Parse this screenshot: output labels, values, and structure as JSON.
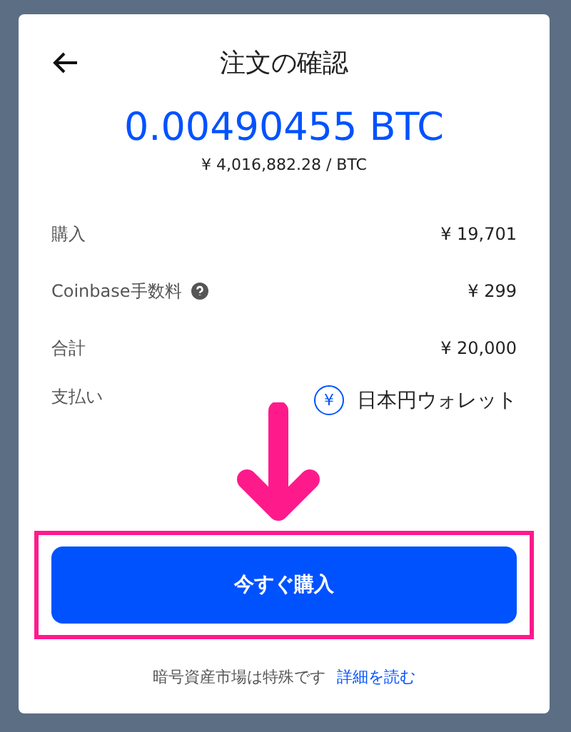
{
  "header": {
    "title": "注文の確認"
  },
  "amount": "0.00490455 BTC",
  "rate": "¥ 4,016,882.28 / BTC",
  "rows": [
    {
      "kind": "plain",
      "label": "購入",
      "value": "¥ 19,701"
    },
    {
      "kind": "help",
      "label": "Coinbase手数料",
      "value": "¥ 299"
    },
    {
      "kind": "plain",
      "label": "合計",
      "value": "¥ 20,000"
    },
    {
      "kind": "payment",
      "label": "支払い",
      "value": "日本円ウォレット",
      "icon_text": "¥"
    }
  ],
  "buy_button": "今すぐ購入",
  "footer": {
    "text": "暗号資産市場は特殊です",
    "link": "詳細を読む"
  }
}
